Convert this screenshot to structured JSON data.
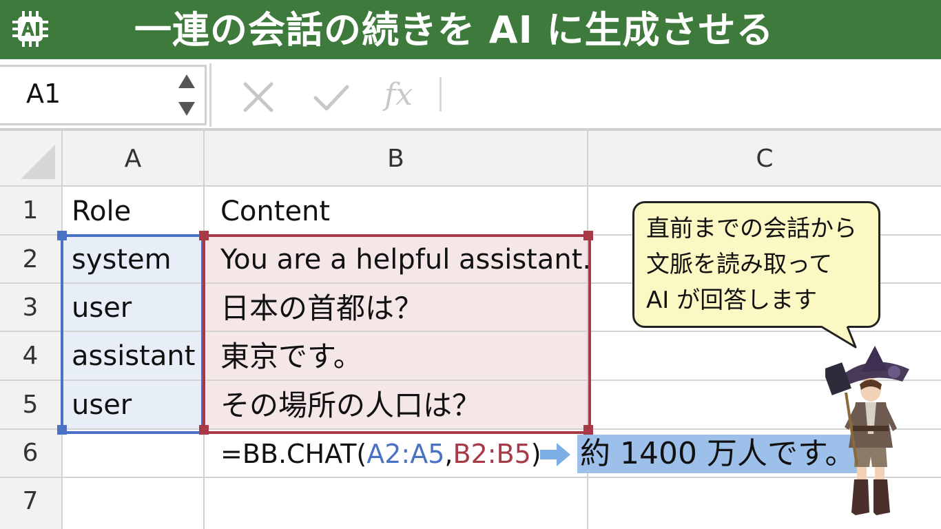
{
  "header": {
    "title": "一連の会話の続きを AI に生成させる",
    "logo_icon": "ai-chip-icon",
    "background_color": "#3f7a3d"
  },
  "formula_bar": {
    "name_box_value": "A1",
    "cancel_icon": "close-icon",
    "enter_icon": "check-icon",
    "function_icon": "fx-icon",
    "fx_label": "fx"
  },
  "grid": {
    "columns": [
      "A",
      "B",
      "C"
    ],
    "rows": [
      "1",
      "2",
      "3",
      "4",
      "5",
      "6",
      "7"
    ],
    "cells": {
      "A1": "Role",
      "B1": "Content",
      "A2": "system",
      "B2": "You are a helpful assistant.",
      "A3": "user",
      "B3": "日本の首都は？",
      "A4": "assistant",
      "B4": "東京です。",
      "A5": "user",
      "B5": "その場所の人口は？"
    },
    "formula": {
      "prefix": "=BB.CHAT(",
      "ref_a": "A2:A5",
      "comma": ",",
      "ref_b": "B2:B5",
      "suffix": ")"
    },
    "result": "約 1400 万人です。",
    "colors": {
      "range_a": "#4a72c4",
      "range_b": "#a83a48",
      "result_highlight": "#9dc0ea"
    }
  },
  "callout": {
    "lines": [
      "直前までの会話から",
      "文脈を読み取って",
      "AI が回答します"
    ]
  }
}
